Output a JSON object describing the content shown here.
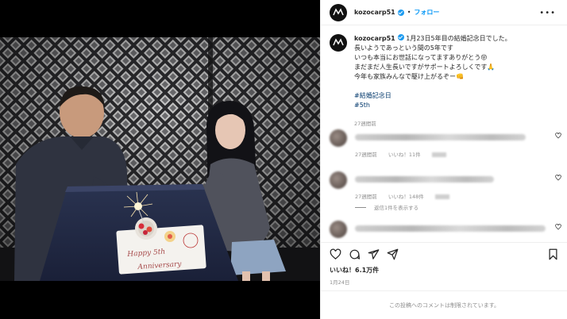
{
  "post": {
    "username": "kozocarp51",
    "separator": "•",
    "follow_label": "フォロー",
    "more_label": "•••",
    "caption": {
      "lines": [
        "1月23日5年目の結婚記念日でした。",
        "長いようであっという間の5年です",
        "いつも本当にお世話になってますありがとう😝",
        "まだまだ人生長いですがサポートよろしくです🙏",
        "今年も家族みんなで駆け上がるぞー👊"
      ],
      "hashtags": [
        "#結婚記念日",
        "#5th"
      ],
      "time": "27週間前"
    },
    "comments": [
      {
        "time": "27週間前",
        "likes": "いいね！11件"
      },
      {
        "time": "27週間前",
        "likes": "いいね！148件"
      },
      {
        "time": "",
        "likes": ""
      }
    ],
    "view_replies": "返信1件を表示する",
    "likes_count": "いいね！6.1万件",
    "date": "1月24日",
    "comments_limited": "この投稿へのコメントは制限されています。"
  },
  "photo": {
    "cake_plate_text_1": "Happy 5th",
    "cake_plate_text_2": "Anniversary"
  },
  "icons": {
    "like": "heart-icon",
    "comment": "comment-icon",
    "share": "share-icon",
    "save": "bookmark-icon"
  },
  "colors": {
    "accent": "#0095f6",
    "verified": "#1d9bf0",
    "muted": "#8e8e8e",
    "hashtag": "#00376b"
  }
}
